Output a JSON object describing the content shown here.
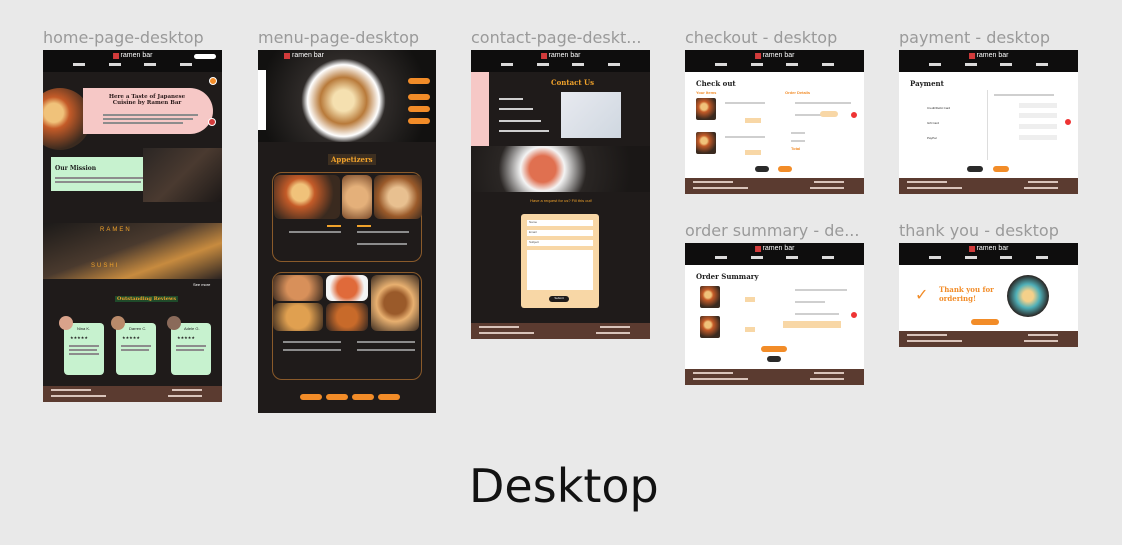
{
  "frames": [
    {
      "id": "home",
      "label": "home-page-desktop"
    },
    {
      "id": "menu",
      "label": "menu-page-desktop"
    },
    {
      "id": "contact",
      "label": "contact-page-deskt..."
    },
    {
      "id": "checkout",
      "label": "checkout - desktop"
    },
    {
      "id": "payment",
      "label": "payment - desktop"
    },
    {
      "id": "summary",
      "label": "order summary - de..."
    },
    {
      "id": "thanks",
      "label": "thank you - desktop"
    }
  ],
  "brand": {
    "name": "ramen bar"
  },
  "home": {
    "hero_title": "Here a Taste of Japanese Cuisine by Ramen Bar",
    "mission_title": "Our Mission",
    "banner_text_1": "RAMEN",
    "banner_text_2": "SUSHI",
    "see_more": "See more",
    "reviews_title": "Outstanding Reviews",
    "reviewers": [
      "Nina K.",
      "Darren C.",
      "Adele G."
    ],
    "stars": "★★★★★"
  },
  "menu": {
    "section_title": "Appetizers"
  },
  "contact": {
    "title": "Contact Us",
    "request_title": "Have a request for us? Fill this out!",
    "fields": [
      "Name",
      "Email",
      "Subject"
    ],
    "submit": "Submit"
  },
  "checkout": {
    "title": "Check out",
    "your_items": "Your Items",
    "order_details": "Order Details",
    "total": "Total"
  },
  "payment": {
    "title": "Payment",
    "methods": [
      "Credit/Debit Card",
      "Gift Card",
      "PayPal"
    ]
  },
  "summary": {
    "title": "Order Summary"
  },
  "thanks": {
    "title": "Thank you for ordering!"
  },
  "board_label": "Desktop",
  "colors": {
    "accent": "#f28c28",
    "dark": "#1f1b1a",
    "footer": "#5b3b30",
    "pink": "#f6c8c6",
    "mint": "#c7f2cf"
  }
}
